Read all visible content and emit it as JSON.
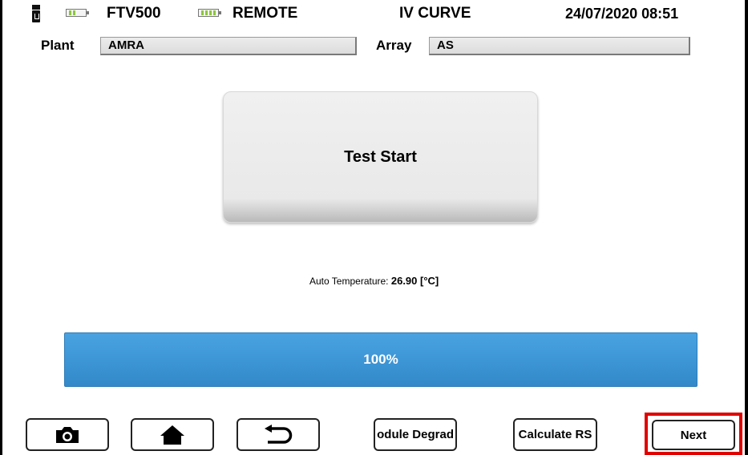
{
  "header": {
    "device_name": "FTV500",
    "mode": "REMOTE",
    "screen_title": "IV CURVE",
    "datetime": "24/07/2020 08:51",
    "icons": [
      "usb-icon",
      "battery-icon",
      "battery-icon"
    ]
  },
  "fields": {
    "plant_label": "Plant",
    "plant_value": "AMRA",
    "array_label": "Array",
    "array_value": "AS"
  },
  "main": {
    "start_button_label": "Test Start",
    "temperature_label": "Auto Temperature:",
    "temperature_value": "26.90 [°C]"
  },
  "progress": {
    "value_percent": 100,
    "label": "100%",
    "color": "#3d96d6"
  },
  "footer": {
    "buttons": [
      {
        "name": "camera",
        "icon": "camera-icon",
        "label": ""
      },
      {
        "name": "home",
        "icon": "home-icon",
        "label": ""
      },
      {
        "name": "back",
        "icon": "back-arrow-icon",
        "label": ""
      },
      {
        "name": "module-degradation",
        "icon": "",
        "label": "odule Degrad"
      },
      {
        "name": "calculate-rs",
        "icon": "",
        "label": "Calculate RS"
      },
      {
        "name": "next",
        "icon": "",
        "label": "Next"
      }
    ],
    "highlight_color": "#e00000"
  }
}
